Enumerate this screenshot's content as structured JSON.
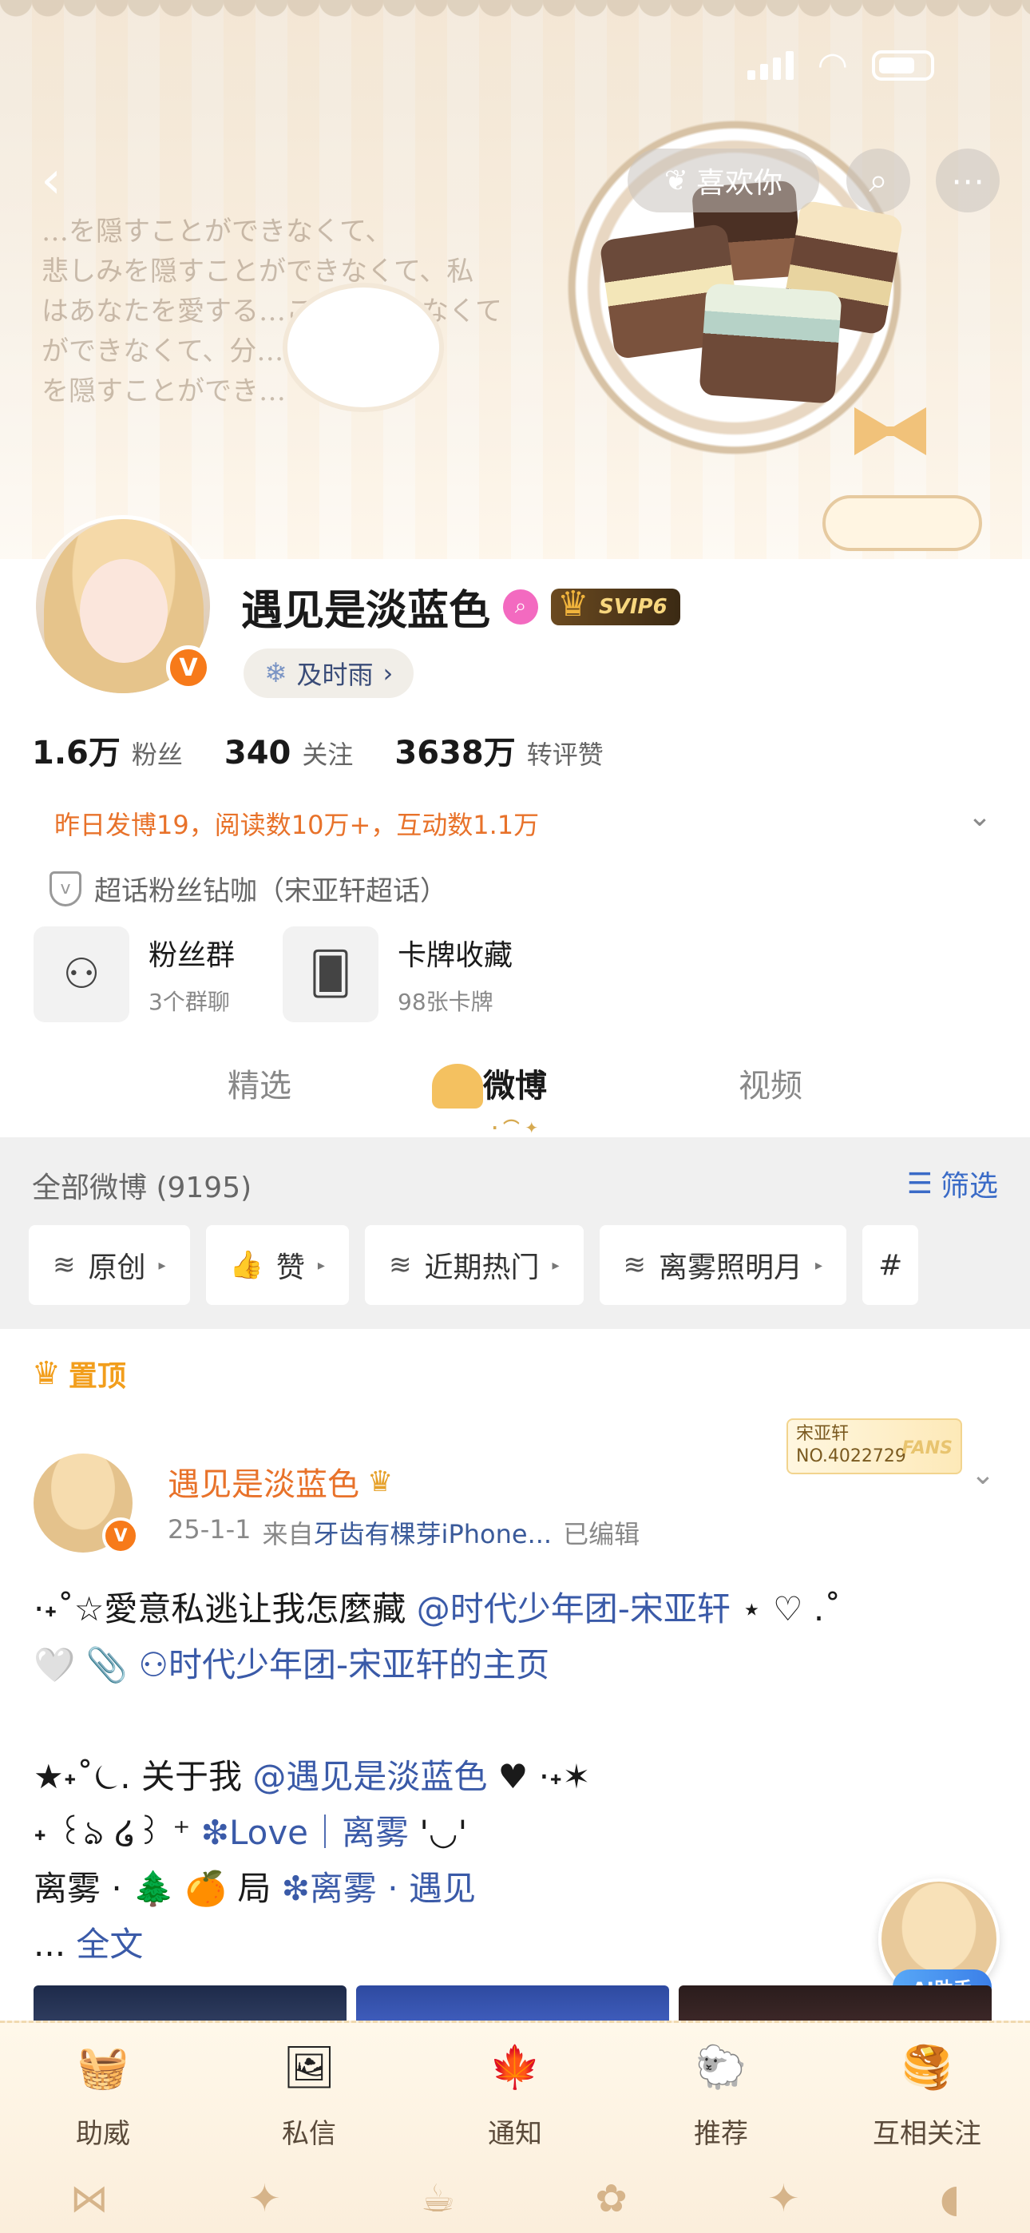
{
  "banner": {
    "jp_lines": [
      "…を隠すことができなくて、",
      "悲しみを隠すことができなくて、私",
      "はあなたを愛する…ことができなくて",
      "ができなくて、分…彷徨",
      "を隠すことができ…"
    ]
  },
  "nav": {
    "back_icon": "‹",
    "like_label": "喜欢你",
    "search_icon": "⌕",
    "more_icon": "⋯"
  },
  "profile": {
    "name": "遇见是淡蓝色",
    "verified_mark": "V",
    "svip_label": "SVIP6",
    "weather_label": "及时雨",
    "stats": [
      {
        "num": "1.6万",
        "label": "粉丝"
      },
      {
        "num": "340",
        "label": "关注"
      },
      {
        "num": "3638万",
        "label": "转评赞"
      }
    ],
    "yesterday_text": "昨日发博19，阅读数10万+，互动数1.1万",
    "chaohua_text": "超话粉丝钻咖（宋亚轩超话）"
  },
  "cards": [
    {
      "title": "粉丝群",
      "sub": "3个群聊",
      "icon": "people-icon"
    },
    {
      "title": "卡牌收藏",
      "sub": "98张卡牌",
      "icon": "card-icon"
    }
  ],
  "tabs": [
    "精选",
    "微博",
    "视频"
  ],
  "feed": {
    "all_label": "全部微博 (9195)",
    "filter_label": "筛选",
    "chips": [
      {
        "icon": "≋",
        "label": "原创"
      },
      {
        "icon": "👍",
        "label": "赞"
      },
      {
        "icon": "≋",
        "label": "近期热门"
      },
      {
        "icon": "≋",
        "label": "离雾照明月"
      }
    ]
  },
  "pinned": {
    "label": "置顶",
    "fan_badge_name": "宋亚轩",
    "fan_badge_no": "NO.4022729",
    "fan_badge_fans": "FANS",
    "author": "遇见是淡蓝色",
    "date": "25-1-1",
    "source_prefix": "来自",
    "source": "牙齿有棵芽iPhone...",
    "edited": "已编辑",
    "line1_a": "·˖˚☆愛意私逃让我怎麼藏",
    "line1_link": "@时代少年团-宋亚轩",
    "line1_b": "⋆ ♡ .˚",
    "line2_a": "🤍 📎",
    "line2_link": "时代少年团-宋亚轩的主页",
    "line3_a": "★˖˚⏾. 关于我",
    "line3_link": "@遇见是淡蓝色",
    "line3_b": "♥ ·˖✶",
    "line4_a": "˖ ꒰ঌ ໒꒱ ⁺",
    "line4_link": "❇Love｜离雾",
    "line4_b": "'◡'",
    "line5_a": "离雾 · 🌲 🍊 局",
    "line5_link": "❇离雾 · 遇见",
    "line6_a": "...",
    "line6_link": "全文",
    "ai_label": "AI助手"
  },
  "bottom_bar": [
    {
      "label": "助威",
      "icon": "🧺"
    },
    {
      "label": "私信",
      "icon": "🖼"
    },
    {
      "label": "通知",
      "icon": "🍁"
    },
    {
      "label": "推荐",
      "icon": "🐑"
    },
    {
      "label": "互相关注",
      "icon": "🥞"
    }
  ],
  "colors": {
    "accent_orange": "#e8722a",
    "link_blue": "#3a5aa8",
    "pin_gold": "#f29e1c"
  }
}
